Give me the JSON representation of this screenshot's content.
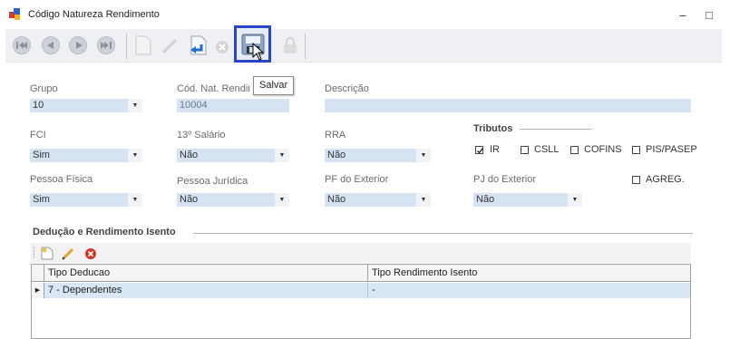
{
  "window": {
    "title": "Código Natureza Rendimento",
    "minimize_glyph": "‒",
    "maximize_glyph": "□",
    "close_glyph": "✕"
  },
  "toolbar": {
    "items": [
      "first-record-icon",
      "previous-record-icon",
      "next-record-icon",
      "last-record-icon",
      "new-icon",
      "edit-icon",
      "undo-icon",
      "cancel-icon",
      "save-icon",
      "lock-icon"
    ]
  },
  "tooltip": {
    "text": "Salvar"
  },
  "form": {
    "grupo": {
      "label": "Grupo",
      "value": "10"
    },
    "cod_nat": {
      "label": "Cód. Nat. Rendim",
      "value": "10004"
    },
    "descricao": {
      "label": "Descrição",
      "value": ""
    },
    "fci": {
      "label": "FCI",
      "value": "Sim"
    },
    "decimo_terceiro": {
      "label": "13º Salário",
      "value": "Não"
    },
    "rra": {
      "label": "RRA",
      "value": "Não"
    },
    "pessoa_fisica": {
      "label": "Pessoa Física",
      "value": "Sim"
    },
    "pessoa_juridica": {
      "label": "Pessoa Jurídica",
      "value": "Não"
    },
    "pf_exterior": {
      "label": "PF do Exterior",
      "value": "Não"
    },
    "pj_exterior": {
      "label": "PJ do Exterior",
      "value": "Não"
    }
  },
  "tributos": {
    "title": "Tributos",
    "items": [
      {
        "label": "IR",
        "checked": true
      },
      {
        "label": "CSLL",
        "checked": false
      },
      {
        "label": "COFINS",
        "checked": false
      },
      {
        "label": "PIS/PASEP",
        "checked": false
      },
      {
        "label": "AGREG.",
        "checked": false
      }
    ]
  },
  "deducao": {
    "title": "Dedução e Rendimento Isento",
    "columns": [
      "Tipo Deducao",
      "Tipo Rendimento Isento"
    ],
    "rows": [
      {
        "tipo_deducao": "7 - Dependentes",
        "tipo_rendimento": "-",
        "row_marker": "▶"
      }
    ]
  },
  "colors": {
    "field_bg": "#d6e3f2",
    "highlight_border": "#2a45c7",
    "selected_row": "#d8e6f5"
  }
}
